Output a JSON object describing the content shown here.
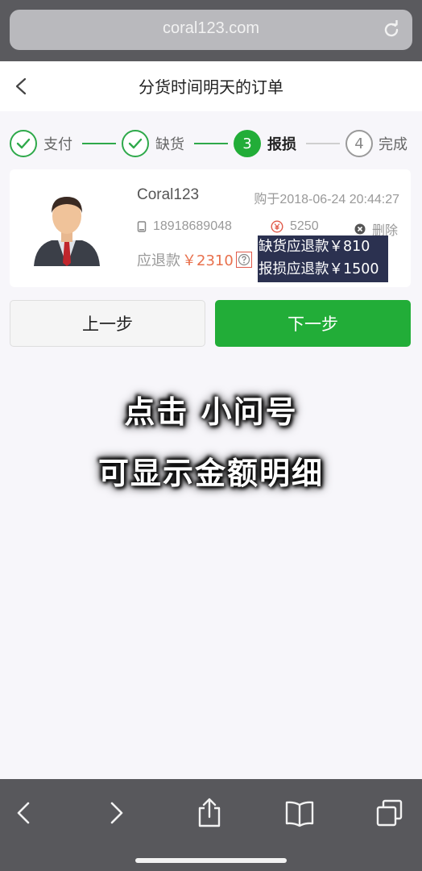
{
  "browser": {
    "url": "coral123.com"
  },
  "header": {
    "title": "分货时间明天的订单"
  },
  "steps": [
    {
      "label": "支付",
      "status": "done"
    },
    {
      "label": "缺货",
      "status": "done"
    },
    {
      "number": "3",
      "label": "报损",
      "status": "active"
    },
    {
      "number": "4",
      "label": "完成",
      "status": "todo"
    }
  ],
  "order": {
    "name": "Coral123",
    "purchase_time": "购于2018-06-24 20:44:27",
    "phone": "18918689048",
    "amount": "5250",
    "delete_label": "删除",
    "refund_label": "应退款",
    "refund_amount": "￥2310"
  },
  "tooltip": {
    "line1": "缺货应退款￥810",
    "line2": "报损应退款￥1500"
  },
  "buttons": {
    "prev": "上一步",
    "next": "下一步"
  },
  "caption": {
    "line1": "点击 小问号",
    "line2": "可显示金额明细"
  },
  "colors": {
    "accent_green": "#22ad38",
    "refund_red": "#e8704c",
    "tooltip_bg": "#2b3150"
  }
}
